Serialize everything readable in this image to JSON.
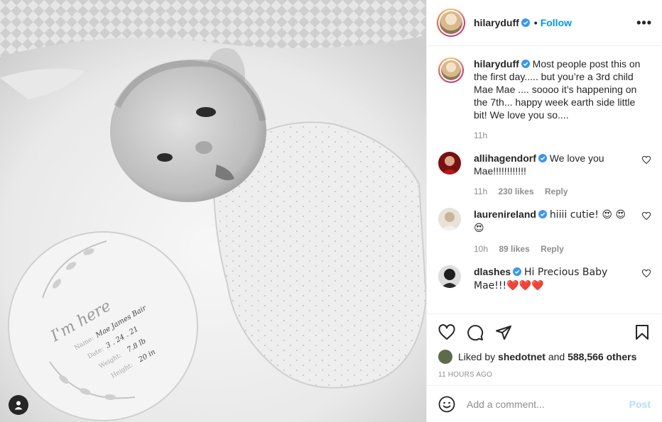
{
  "post": {
    "author": "hilaryduff",
    "follow_label": "Follow",
    "dot": "•",
    "more_label": "•••",
    "caption": "Most people post this on the first day..... but you’re a 3rd child Mae Mae .... soooo it’s happening on the 7th... happy week earth side little bit! We love you so....",
    "caption_time": "11h"
  },
  "milestone_card": {
    "heading": "I'm here",
    "name_label": "Name:",
    "name_value": "Mae James Bair",
    "date_label": "Date:",
    "date_value": "3 . 24 . 21",
    "weight_label": "Weight:",
    "weight_value": "7.8 lb",
    "height_label": "Height:",
    "height_value": "20 in"
  },
  "comments": [
    {
      "user": "allihagendorf",
      "text": "We love you Mae!!!!!!!!!!!!",
      "time": "11h",
      "likes": "230 likes",
      "reply": "Reply"
    },
    {
      "user": "laurenireland",
      "text": "hiiii cutie! 😍 😍😍",
      "time": "10h",
      "likes": "89 likes",
      "reply": "Reply"
    },
    {
      "user": "dlashes",
      "text": "Hi Precious Baby Mae!!!❤️❤️❤️",
      "time": "",
      "likes": "",
      "reply": ""
    }
  ],
  "likes": {
    "prefix": "Liked by",
    "user": "shedotnet",
    "and": "and",
    "others": "588,566 others"
  },
  "timestamp": "11 HOURS AGO",
  "add_comment": {
    "placeholder": "Add a comment...",
    "post_label": "Post"
  },
  "colors": {
    "accent": "#0095f6",
    "post_disabled": "#b2dffc",
    "verified": "#3897f0",
    "muted": "#8e8e8e"
  },
  "icons": [
    "heart-icon",
    "comment-icon",
    "share-icon",
    "save-icon",
    "smile-icon",
    "user-tag-icon",
    "more-icon",
    "verified-icon"
  ]
}
